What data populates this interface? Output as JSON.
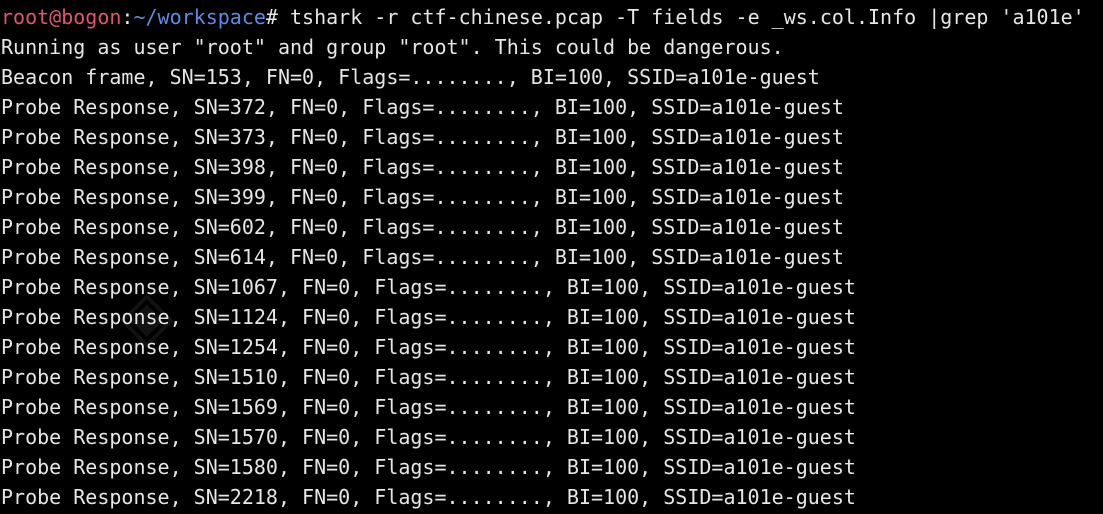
{
  "prompt": {
    "user_host": "root@bogon",
    "separator": ":",
    "path": "~/workspace",
    "hash": "# ",
    "command": "tshark -r ctf-chinese.pcap -T fields -e _ws.col.Info |grep 'a101e'"
  },
  "output_lines": [
    "Running as user \"root\" and group \"root\". This could be dangerous.",
    "Beacon frame, SN=153, FN=0, Flags=........, BI=100, SSID=a101e-guest",
    "Probe Response, SN=372, FN=0, Flags=........, BI=100, SSID=a101e-guest",
    "Probe Response, SN=373, FN=0, Flags=........, BI=100, SSID=a101e-guest",
    "Probe Response, SN=398, FN=0, Flags=........, BI=100, SSID=a101e-guest",
    "Probe Response, SN=399, FN=0, Flags=........, BI=100, SSID=a101e-guest",
    "Probe Response, SN=602, FN=0, Flags=........, BI=100, SSID=a101e-guest",
    "Probe Response, SN=614, FN=0, Flags=........, BI=100, SSID=a101e-guest",
    "Probe Response, SN=1067, FN=0, Flags=........, BI=100, SSID=a101e-guest",
    "Probe Response, SN=1124, FN=0, Flags=........, BI=100, SSID=a101e-guest",
    "Probe Response, SN=1254, FN=0, Flags=........, BI=100, SSID=a101e-guest",
    "Probe Response, SN=1510, FN=0, Flags=........, BI=100, SSID=a101e-guest",
    "Probe Response, SN=1569, FN=0, Flags=........, BI=100, SSID=a101e-guest",
    "Probe Response, SN=1570, FN=0, Flags=........, BI=100, SSID=a101e-guest",
    "Probe Response, SN=1580, FN=0, Flags=........, BI=100, SSID=a101e-guest",
    "Probe Response, SN=2218, FN=0, Flags=........, BI=100, SSID=a101e-guest"
  ],
  "colors": {
    "background": "#000000",
    "text": "#e6e6e6",
    "prompt_user": "#e0566b",
    "prompt_path": "#5c8ce6"
  }
}
